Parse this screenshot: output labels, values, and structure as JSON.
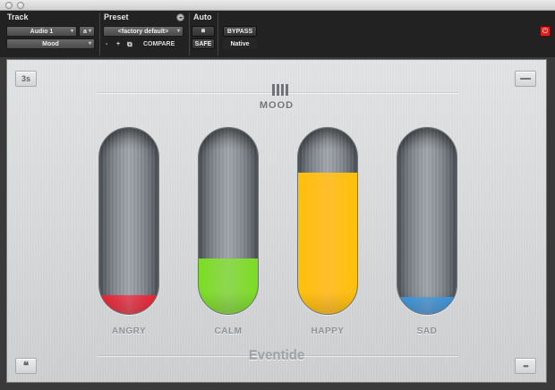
{
  "header": {
    "track_label": "Track",
    "preset_label": "Preset",
    "auto_label": "Auto",
    "track_name": "Audio 1",
    "track_letter": "a",
    "plugin_name": "Mood",
    "preset_name": "<factory default>",
    "minus": "-",
    "plus": "+",
    "compare": "COMPARE",
    "safe": "SAFE",
    "bypass": "BYPASS",
    "native": "Native"
  },
  "panel": {
    "title": "MOOD",
    "top_left_button": "3s",
    "bottom_left_button": "❝",
    "bottom_right_button": "•••",
    "brand": "Eventide"
  },
  "meters": [
    {
      "label": "ANGRY",
      "level": 0.1,
      "color": "#e03a48"
    },
    {
      "label": "CALM",
      "level": 0.3,
      "color": "#7ccf3c"
    },
    {
      "label": "HAPPY",
      "level": 0.76,
      "color": "#ffb21e"
    },
    {
      "label": "SAD",
      "level": 0.09,
      "color": "#4a8fcf"
    }
  ]
}
